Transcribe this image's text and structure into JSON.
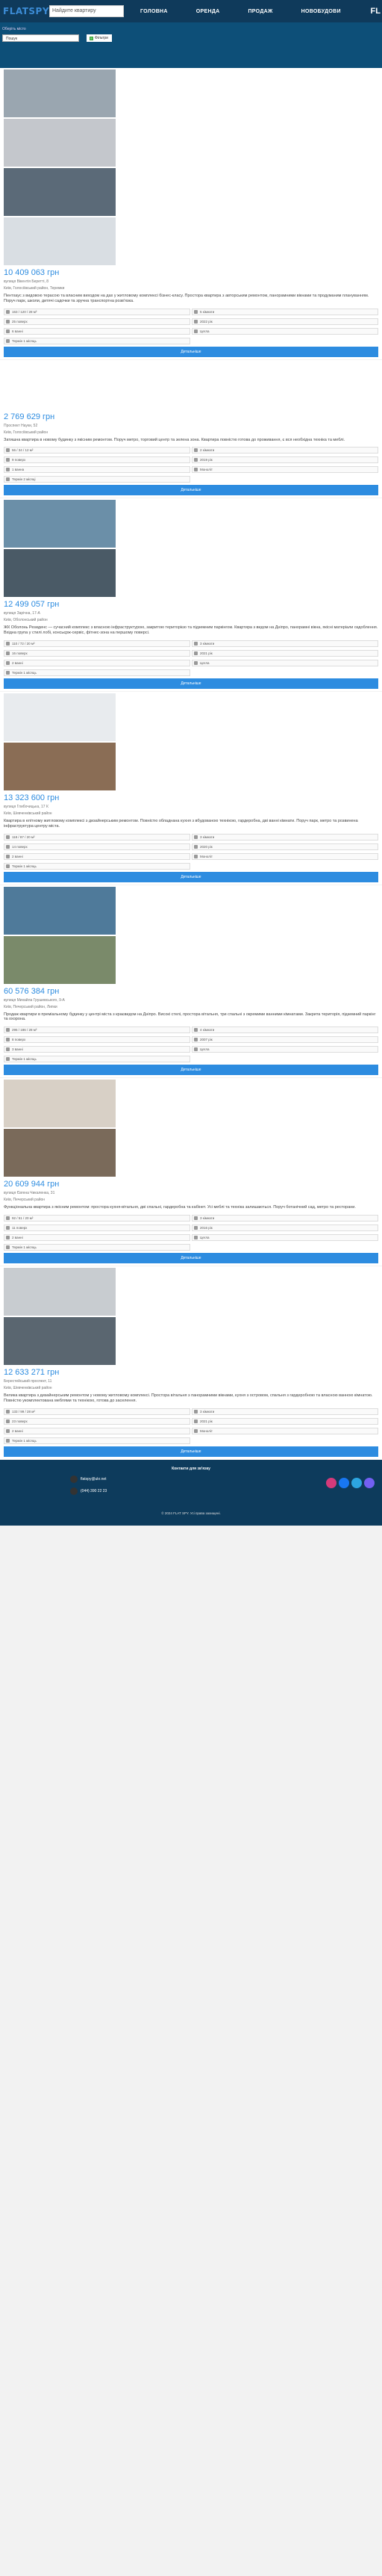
{
  "header": {
    "logo": "FLATSPY",
    "search_placeholder": "Найдите квартиру",
    "nav": [
      "ГОЛОВНА",
      "ОРЕНДА",
      "ПРОДАЖ",
      "НОВОБУДОВИ"
    ],
    "lang": "FL"
  },
  "filters": {
    "city": "Оберіть місто",
    "search_placeholder": "Пошук",
    "toggle_label": "Фільтри"
  },
  "listings": [
    {
      "price": "10 409 063 грн",
      "address": "вулиця Вікентія Беретті, 8",
      "district": "Київ, Голосіївський район, Теремки",
      "description": "Пентхаус з видовою терасою та власним виходом на дах у житловому комплексі бізнес-класу. Простора квартира з авторським ремонтом, панорамними вікнами та продуманим плануванням. Поруч парк, школи, дитячі садочки та зручна транспортна розв'язка.",
      "stats": [
        "163 / 120 / 28 м²",
        "5 кімнати",
        "25 поверх",
        "2022 рік",
        "6 ванні",
        "Цегла",
        "Термін 1 місяць"
      ],
      "btn": "Детальніше",
      "colors": [
        "#9aa6b0",
        "#c4c7cc",
        "#5b6a78",
        "#d9dee3"
      ]
    },
    {
      "price": "2 769 629 грн",
      "address": "Проспект Науки, 52",
      "district": "Київ, Голосіївський район",
      "description": "Затишна квартира в новому будинку з якісним ремонтом. Поруч метро, торговий центр та зелена зона. Квартира повністю готова до проживання, є вся необхідна техніка та меблі.",
      "stats": [
        "56 / 34 / 12 м²",
        "2 кімнати",
        "9 поверх",
        "2019 рік",
        "1 ванна",
        "Моноліт",
        "Термін 2 місяці"
      ],
      "btn": "Детальніше",
      "colors": [
        "#ffffff"
      ]
    },
    {
      "price": "12 499 057 грн",
      "address": "вулиця Зарічна, 17-А",
      "district": "Київ, Оболонський район",
      "description": "ЖК Оболонь Резиденс — сучасний комплекс з власною інфраструктурою, закритою територією та підземним паркінгом. Квартира з видом на Дніпро, панорамні вікна, якісні матеріали оздоблення. Вхідна група у стилі лобі, консьєрж-сервіс, фітнес-зона на першому поверсі.",
      "stats": [
        "110 / 72 / 20 м²",
        "3 кімнати",
        "16 поверх",
        "2021 рік",
        "2 ванні",
        "Цегла",
        "Термін 1 місяць"
      ],
      "btn": "Детальніше",
      "colors": [
        "#6b8fa8",
        "#4a5a66"
      ]
    },
    {
      "price": "13 323 600 грн",
      "address": "вулиця Глибочицька, 17 К",
      "district": "Київ, Шевченківський район",
      "description": "Квартира в елітному житловому комплексі з дизайнерським ремонтом. Повністю обладнана кухня з вбудованою технікою, гардеробна, дві ванні кімнати. Поруч парк, метро та розвинена інфраструктура центру міста.",
      "stats": [
        "118 / 87 / 20 м²",
        "3 кімнати",
        "14 поверх",
        "2020 рік",
        "2 ванні",
        "Моноліт",
        "Термін 1 місяць"
      ],
      "btn": "Детальніше",
      "colors": [
        "#e8ebee",
        "#8a6d55"
      ]
    },
    {
      "price": "60 576 384 грн",
      "address": "вулиця Михайла Грушевського, 9-А",
      "district": "Київ, Печерський район, Липки",
      "description": "Продаж квартири в преміальному будинку у центрі міста з краєвидом на Дніпро. Високі стелі, простора вітальня, три спальні з окремими ванними кімнатами. Закрита територія, підземний паркінг та охорона.",
      "stats": [
        "295 / 186 / 28 м²",
        "4 кімнати",
        "8 поверх",
        "2007 рік",
        "3 ванні",
        "Цегла",
        "Термін 1 місяць"
      ],
      "btn": "Детальніше",
      "colors": [
        "#4f7a9a",
        "#7a8a6a"
      ]
    },
    {
      "price": "20 609 944 грн",
      "address": "вулиця Євгена Чикаленка, 31",
      "district": "Київ, Печерський район",
      "description": "Функціональна квартира з якісним ремонтом: простора кухня-вітальня, дві спальні, гардеробна та кабінет. Усі меблі та техніка залишаються. Поруч ботанічний сад, метро та ресторани.",
      "stats": [
        "92 / 51 / 20 м²",
        "3 кімнати",
        "11 поверх",
        "2016 рік",
        "2 ванні",
        "Цегла",
        "Термін 1 місяць"
      ],
      "btn": "Детальніше",
      "colors": [
        "#d8d0c6",
        "#7a6a5a"
      ]
    },
    {
      "price": "12 633 271 грн",
      "address": "Берестейський проспект, 11",
      "district": "Київ, Шевченківський район",
      "description": "Велика квартира з дизайнерським ремонтом у новому житловому комплексі. Простора вітальня з панорамними вікнами, кухня з островом, спальня з гардеробною та власною ванною кімнатою. Повністю укомплектована меблями та технікою, готова до заселення.",
      "stats": [
        "133 / 99 / 28 м²",
        "3 кімнати",
        "23 поверх",
        "2021 рік",
        "2 ванні",
        "Моноліт",
        "Термін 1 місяць"
      ],
      "btn": "Детальніше",
      "colors": [
        "#c8ccd0",
        "#5a6670"
      ]
    }
  ],
  "footer": {
    "heading": "Контакти для зв'язку",
    "email": "flatspy@ukr.net",
    "phone": "(044) 390 22 23",
    "copyright": "© 2024 FLAT SPY. Усі права захищені."
  }
}
